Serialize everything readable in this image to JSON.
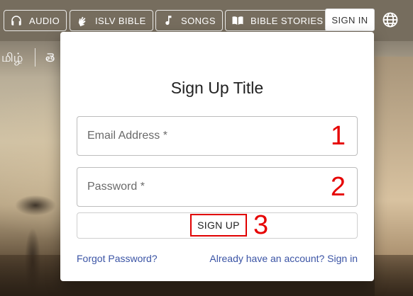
{
  "nav": {
    "audio": {
      "label": "AUDIO",
      "icon": "headphones-icon"
    },
    "islv_bible": {
      "label": "ISLV BIBLE",
      "icon": "sign-language-icon"
    },
    "songs": {
      "label": "SONGS",
      "icon": "music-note-icon"
    },
    "bible_stories": {
      "label": "BIBLE STORIES",
      "icon": "open-book-icon"
    },
    "sign_in": "SIGN IN",
    "language_icon": "globe-icon"
  },
  "languages": [
    "மிழ்",
    "తె"
  ],
  "dialog": {
    "title": "Sign Up Title",
    "email_placeholder": "Email Address *",
    "email_marker": "1",
    "password_placeholder": "Password *",
    "password_marker": "2",
    "signup_label": "SIGN UP",
    "signup_marker": "3",
    "forgot_password": "Forgot Password?",
    "sign_in_link": "Already have an account? Sign in"
  },
  "colors": {
    "marker": "#e60000",
    "link": "#3b54a5",
    "topbar": "#766c5e"
  }
}
